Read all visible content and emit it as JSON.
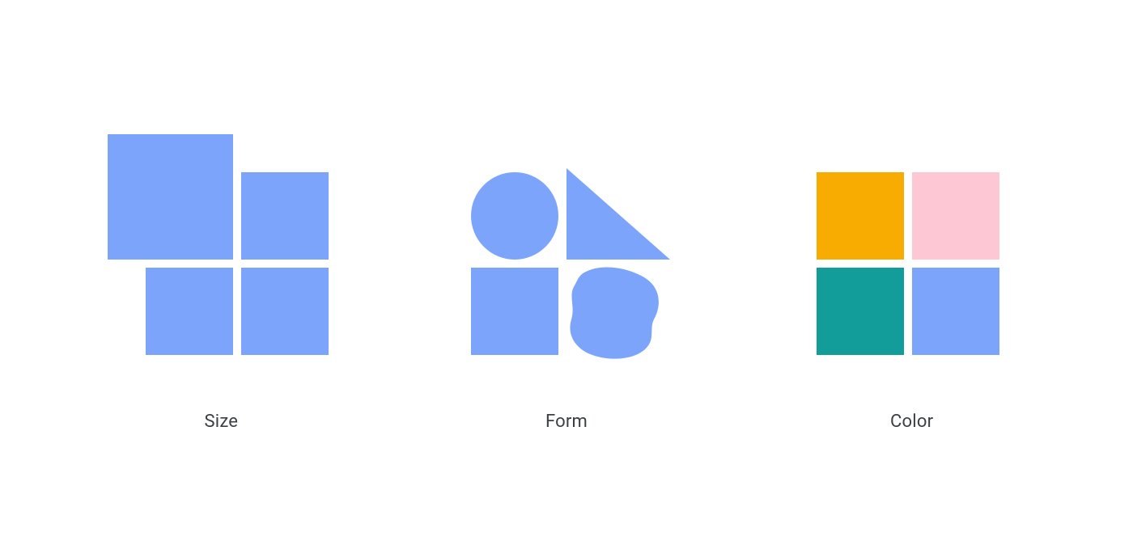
{
  "panels": {
    "size": {
      "label": "Size"
    },
    "form": {
      "label": "Form"
    },
    "color": {
      "label": "Color"
    }
  },
  "colors": {
    "blue": "#7ba4fa",
    "amber": "#f8ab00",
    "pink": "#fdc7d3",
    "teal": "#129d9a"
  }
}
